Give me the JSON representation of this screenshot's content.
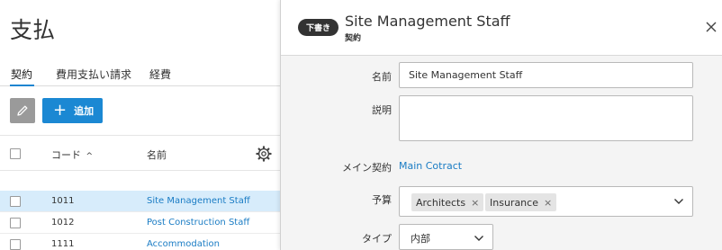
{
  "left": {
    "title": "支払",
    "tabs": [
      "契約",
      "費用支払い請求",
      "経費"
    ],
    "add_label": "追加",
    "columns": {
      "code": "コード",
      "sort_indicator": "^",
      "name": "名前"
    },
    "rows": [
      {
        "code": "1011",
        "name": "Site Management Staff",
        "selected": true
      },
      {
        "code": "1012",
        "name": "Post Construction Staff",
        "selected": false
      },
      {
        "code": "1111",
        "name": "Accommodation",
        "selected": false
      }
    ]
  },
  "panel": {
    "badge": "下書き",
    "title": "Site Management Staff",
    "subtitle": "契約",
    "fields": {
      "name_label": "名前",
      "name_value": "Site Management Staff",
      "description_label": "説明",
      "description_value": "",
      "main_contract_label": "メイン契約",
      "main_contract_value": "Main Cotract",
      "budget_label": "予算",
      "budget_chips": [
        "Architects",
        "Insurance"
      ],
      "type_label": "タイプ",
      "type_value": "内部"
    }
  },
  "colors": {
    "accent": "#1b88d3",
    "link": "#1a7cc4",
    "selected_row": "#d7ecfb",
    "badge_bg": "#333333"
  },
  "icons": [
    "pencil-icon",
    "plus-icon",
    "gear-icon",
    "close-icon",
    "chevron-down-icon"
  ]
}
